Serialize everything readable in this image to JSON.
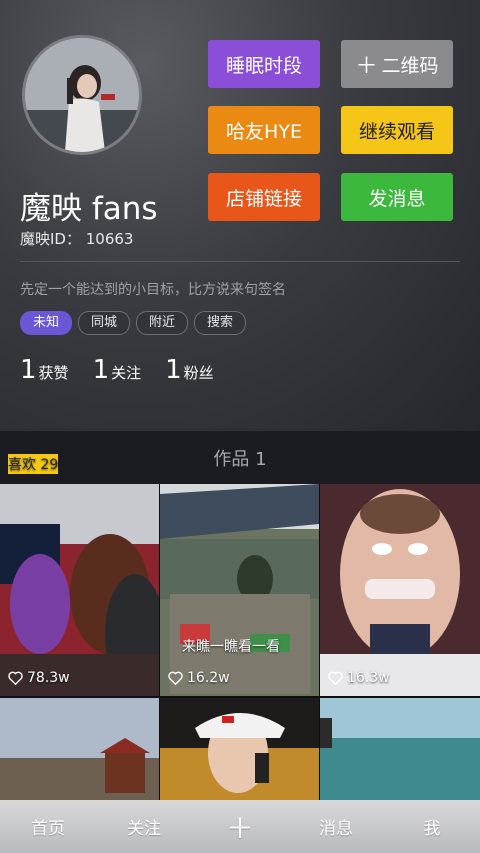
{
  "profile": {
    "name": "魔映 fans",
    "id_line": "魔映ID： 10663",
    "signature": "先定一个能达到的小目标，比方说来句签名"
  },
  "actions": {
    "sleep": "睡眠时段",
    "qrcode": "二维码",
    "qrcode_icon": "plus-icon",
    "hye": "哈友HYE",
    "continue": "继续观看",
    "shop": "店铺链接",
    "message": "发消息"
  },
  "colors": {
    "sleep": "#8a4fd6",
    "qrcode": "#8b8b8f",
    "hye": "#ea8a12",
    "continue": "#f5c518",
    "shop": "#e8561a",
    "message": "#3cb93c",
    "tag_active": "#6b57d6",
    "tab_active": "#f6c917"
  },
  "tags": [
    "未知",
    "同城",
    "附近",
    "搜索"
  ],
  "stats": [
    {
      "num": "1",
      "label": "获赞"
    },
    {
      "num": "1",
      "label": "关注"
    },
    {
      "num": "1",
      "label": "粉丝"
    }
  ],
  "tabs": {
    "works": "作品 1",
    "likes": "喜欢 29"
  },
  "grid": [
    {
      "likes": "78.3w"
    },
    {
      "likes": "16.2w",
      "caption": "来瞧一瞧看一看"
    },
    {
      "likes": "16.3w"
    },
    {},
    {},
    {}
  ],
  "nav": {
    "home": "首页",
    "follow": "关注",
    "plus": "＋",
    "messages": "消息",
    "me": "我"
  }
}
